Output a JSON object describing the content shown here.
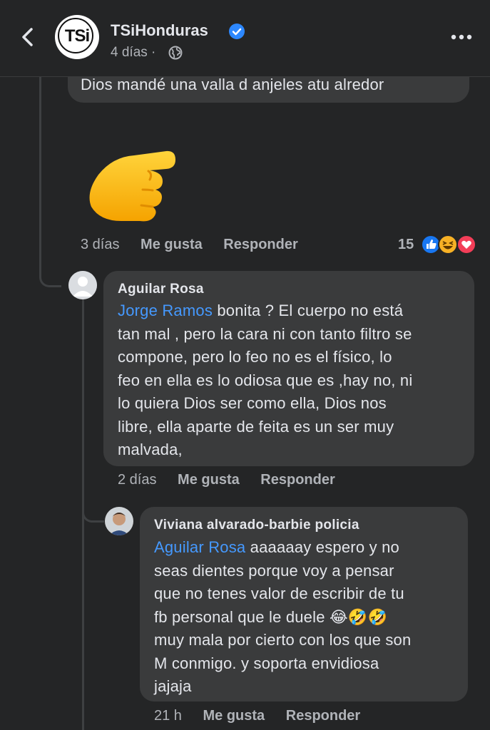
{
  "header": {
    "page_name": "TSiHonduras",
    "logo_text": "TSi",
    "post_time": "4 días",
    "separator": "·"
  },
  "comments": [
    {
      "text": "Dios mandé una valla d anjeles atu alredor",
      "reaction_emoji": "👉",
      "time": "3 días",
      "like_label": "Me gusta",
      "reply_label": "Responder",
      "reaction_count": "15"
    },
    {
      "author": "Aguilar Rosa",
      "mention": "Jorge Ramos",
      "lines": [
        " bonita ? El cuerpo no está",
        "tan mal , pero la cara ni con tanto filtro se",
        "compone, pero lo feo no es el físico, lo",
        "feo en ella es lo odiosa que es ,hay no, ni",
        "lo quiera Dios ser como ella, Dios nos",
        "libre, ella aparte de feita es un ser muy",
        "malvada,"
      ],
      "time": "2 días",
      "like_label": "Me gusta",
      "reply_label": "Responder"
    },
    {
      "author": "Viviana alvarado-barbie policia",
      "mention": "Aguilar Rosa",
      "lines": [
        " aaaaaay espero y no",
        "seas dientes porque voy a pensar",
        "que no tenes valor de escribir de tu",
        "fb personal que le duele",
        "muy mala por cierto con los que son",
        "M conmigo. y soporta envidiosa",
        "jajaja"
      ],
      "emojis": "😂🤣🤣",
      "time": "21 h",
      "like_label": "Me gusta",
      "reply_label": "Responder"
    }
  ],
  "colors": {
    "background": "#242526",
    "bubble": "#3a3b3c",
    "mention": "#4599ff",
    "muted": "#b0b3b8",
    "verified": "#2d88ff"
  }
}
